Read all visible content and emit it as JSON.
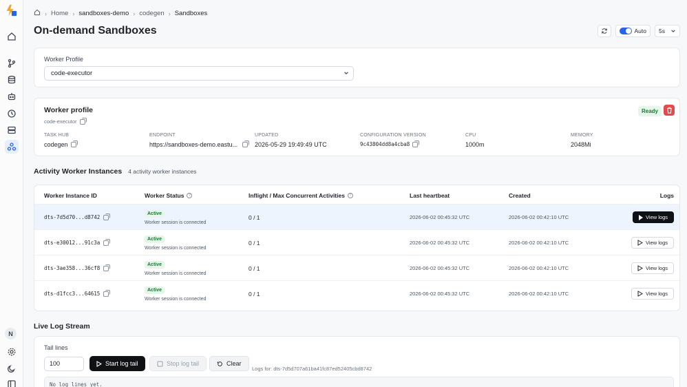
{
  "breadcrumb": {
    "home": "Home",
    "org": "sandboxes-demo",
    "project": "codegen",
    "current": "Sandboxes"
  },
  "page": {
    "title": "On-demand Sandboxes"
  },
  "controls": {
    "auto_label": "Auto",
    "interval": "5s"
  },
  "sidebar": {
    "avatar_initial": "N"
  },
  "profile_select": {
    "label": "Worker Profile",
    "value": "code-executor"
  },
  "worker_profile": {
    "title": "Worker profile",
    "name": "code-executor",
    "status": "Ready",
    "fields": [
      {
        "key": "TASK HUB",
        "value": "codegen"
      },
      {
        "key": "ENDPOINT",
        "value": "https://sandboxes-demo.eastu..."
      },
      {
        "key": "UPDATED",
        "value": "2026-05-29 19:49:49 UTC"
      },
      {
        "key": "CONFIGURATION VERSION",
        "value": "9c43804dd8a4cba8"
      },
      {
        "key": "CPU",
        "value": "1000m"
      },
      {
        "key": "MEMORY",
        "value": "2048Mi"
      }
    ]
  },
  "instances": {
    "title": "Activity Worker Instances",
    "count": "4 activity worker instances",
    "columns": [
      "Worker Instance ID",
      "Worker Status",
      "Inflight / Max Concurrent Activities",
      "Last heartbeat",
      "Created",
      "Logs"
    ],
    "rows": [
      {
        "id": "dts-7d5d70...d8742",
        "status": "Active",
        "status_detail": "Worker session is connected",
        "inflight": "0 / 1",
        "heartbeat": "2026-06-02 00:45:32 UTC",
        "created": "2026-06-02 00:42:10 UTC",
        "action": "View logs"
      },
      {
        "id": "dts-e30012...91c3a",
        "status": "Active",
        "status_detail": "Worker session is connected",
        "inflight": "0 / 1",
        "heartbeat": "2026-06-02 00:45:32 UTC",
        "created": "2026-06-02 00:42:10 UTC",
        "action": "View logs"
      },
      {
        "id": "dts-3ae358...36cf8",
        "status": "Active",
        "status_detail": "Worker session is connected",
        "inflight": "0 / 1",
        "heartbeat": "2026-06-02 00:45:32 UTC",
        "created": "2026-06-02 00:42:10 UTC",
        "action": "View logs"
      },
      {
        "id": "dts-d1fcc3...64615",
        "status": "Active",
        "status_detail": "Worker session is connected",
        "inflight": "0 / 1",
        "heartbeat": "2026-06-02 00:45:32 UTC",
        "created": "2026-06-02 00:42:10 UTC",
        "action": "View logs"
      }
    ]
  },
  "live_log": {
    "title": "Live Log Stream",
    "tail_label": "Tail lines",
    "tail_value": "100",
    "start_label": "Start log tail",
    "stop_label": "Stop log tail",
    "clear_label": "Clear",
    "logs_for": "Logs for: dts-7d5d707a61ba41fc87ed52405cbd8742",
    "empty": "No log lines yet."
  },
  "colors": {
    "accent": "#2563eb",
    "success_bg": "#e6f6ea",
    "success_fg": "#177a35",
    "danger": "#e5484d"
  }
}
